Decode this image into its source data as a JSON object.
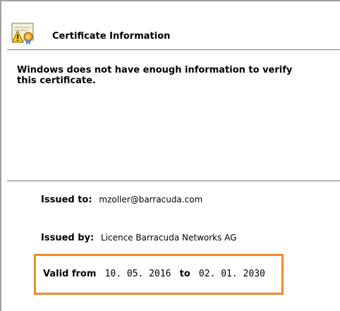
{
  "header": {
    "title": "Certificate Information",
    "icon": "certificate-warning-icon"
  },
  "warning_text": "Windows does not have enough information to verify this certificate.",
  "details": {
    "issued_to_label": "Issued to:",
    "issued_to_value": "mzoller@barracuda.com",
    "issued_by_label": "Issued by:",
    "issued_by_value": "Licence Barracuda Networks AG",
    "valid_from_label": "Valid from",
    "valid_from_value": "10. 05. 2016",
    "valid_to_label": "to",
    "valid_to_value": "02. 01. 2030"
  },
  "colors": {
    "highlight": "#ef8a2e",
    "separator": "#777777",
    "frame": "#a0a0a0"
  }
}
